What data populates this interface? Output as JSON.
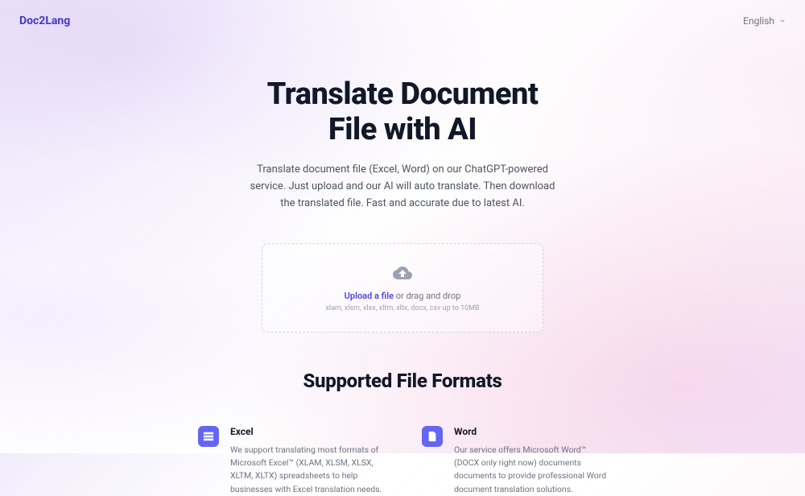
{
  "header": {
    "logo": "Doc2Lang",
    "language": "English"
  },
  "hero": {
    "title_line1": "Translate Document",
    "title_line2": "File with AI",
    "subtitle": "Translate document file (Excel, Word) on our ChatGPT-powered service. Just upload and our AI will auto translate. Then download the translated file. Fast and accurate due to latest AI."
  },
  "upload": {
    "link_text": "Upload a file",
    "suffix_text": " or drag and drop",
    "hint": "xlam, xlsm, xlsx, xltm, xltx, docx, csv up to 10MB"
  },
  "formats": {
    "title": "Supported File Formats",
    "items": [
      {
        "name": "Excel",
        "desc": "We support translating most formats of Microsoft Excel™ (XLAM, XLSM, XLSX, XLTM, XLTX) spreadsheets to help businesses with Excel translation needs."
      },
      {
        "name": "Word",
        "desc": "Our service offers Microsoft Word™ (DOCX only right now) documents documents to provide professional Word document translation solutions."
      }
    ]
  }
}
